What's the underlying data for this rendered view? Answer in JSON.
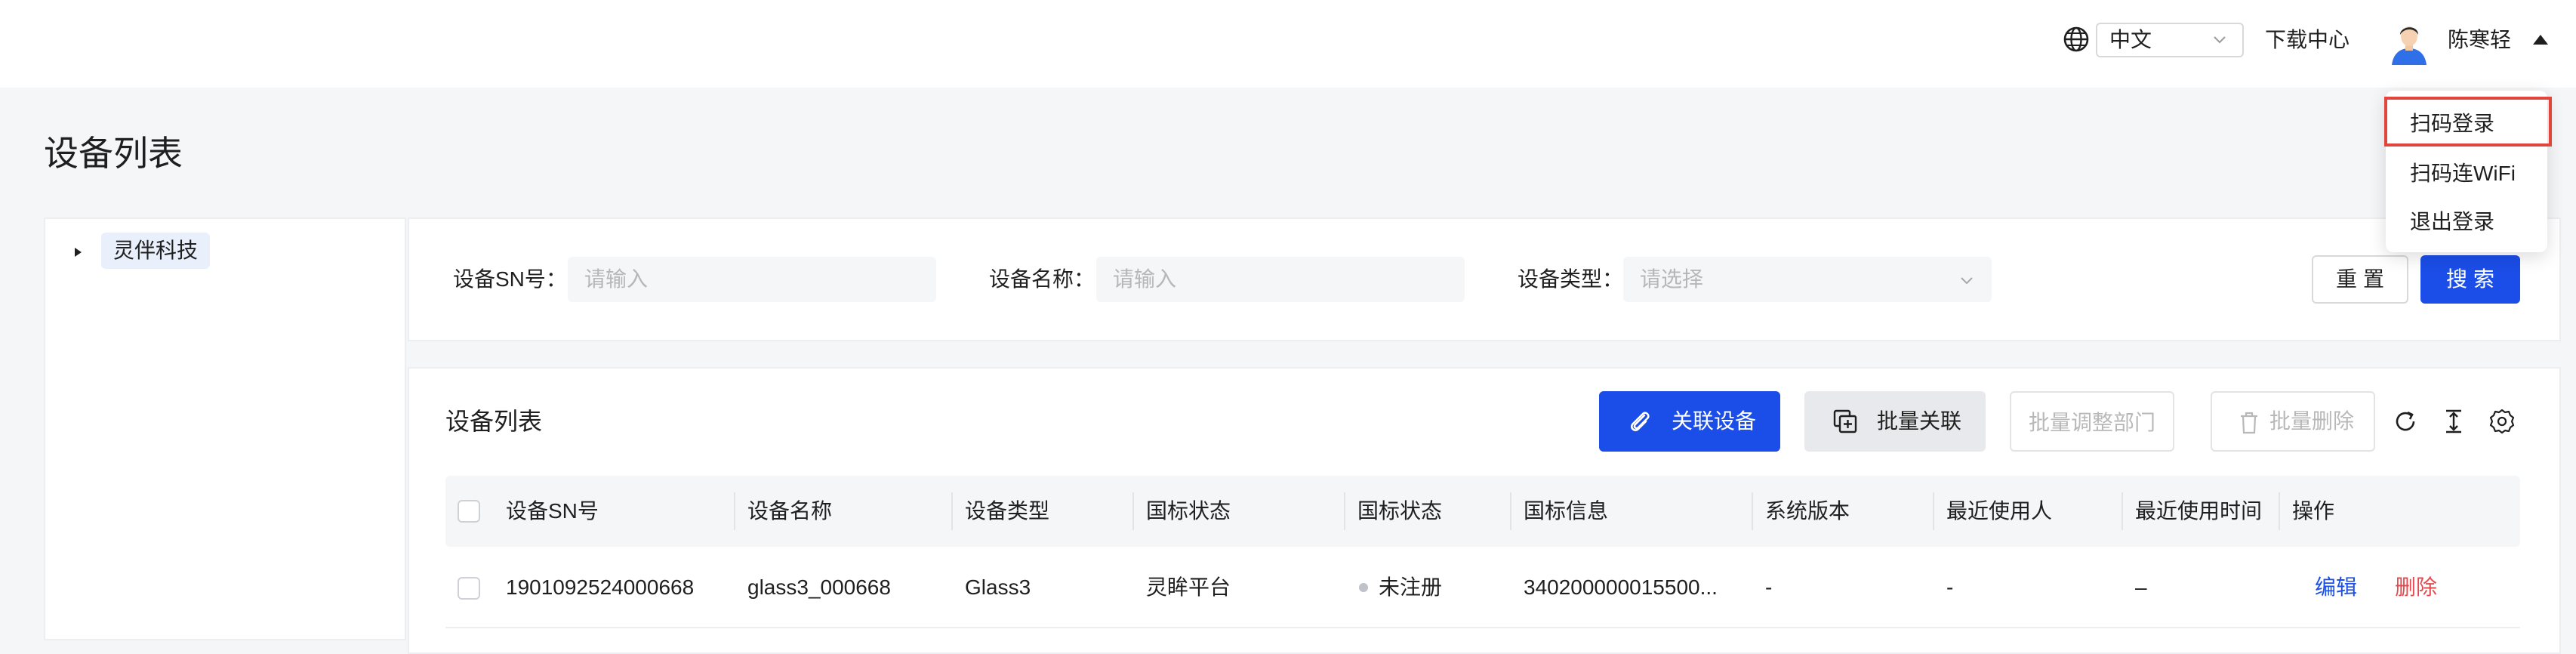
{
  "header": {
    "language": "中文",
    "download_center": "下载中心",
    "username": "陈寒轻",
    "icons": [
      "globe-icon",
      "chevron-down-icon",
      "avatar",
      "caret-up-icon"
    ]
  },
  "user_menu": {
    "items": [
      "扫码登录",
      "扫码连WiFi",
      "退出登录"
    ],
    "highlight_color": "#e2453c"
  },
  "page": {
    "title": "设备列表"
  },
  "tree": {
    "nodes": [
      {
        "label": "灵伴科技"
      }
    ]
  },
  "search": {
    "sn_label": "设备SN号：",
    "sn_placeholder": "请输入",
    "name_label": "设备名称：",
    "name_placeholder": "请输入",
    "type_label": "设备类型：",
    "type_placeholder": "请选择",
    "reset": "重置",
    "submit": "搜索"
  },
  "list": {
    "title": "设备列表",
    "actions": {
      "link_device": "关联设备",
      "batch_link": "批量关联",
      "batch_adjust_dept": "批量调整部门",
      "batch_delete": "批量删除"
    },
    "columns": [
      "设备SN号",
      "设备名称",
      "设备类型",
      "国标状态",
      "国标状态",
      "国标信息",
      "系统版本",
      "最近使用人",
      "最近使用时间",
      "操作"
    ],
    "rows": [
      {
        "sn": "1901092524000668",
        "name": "glass3_000668",
        "type": "Glass3",
        "gb_platform": "灵眸平台",
        "gb_status": "未注册",
        "gb_info": "340200000015500...",
        "version": "-",
        "last_user": "-",
        "last_time": "–",
        "edit": "编辑",
        "delete": "删除"
      }
    ]
  },
  "colors": {
    "primary": "#1b4ee8",
    "danger": "#e5484d",
    "page_bg": "#f5f6f8"
  }
}
